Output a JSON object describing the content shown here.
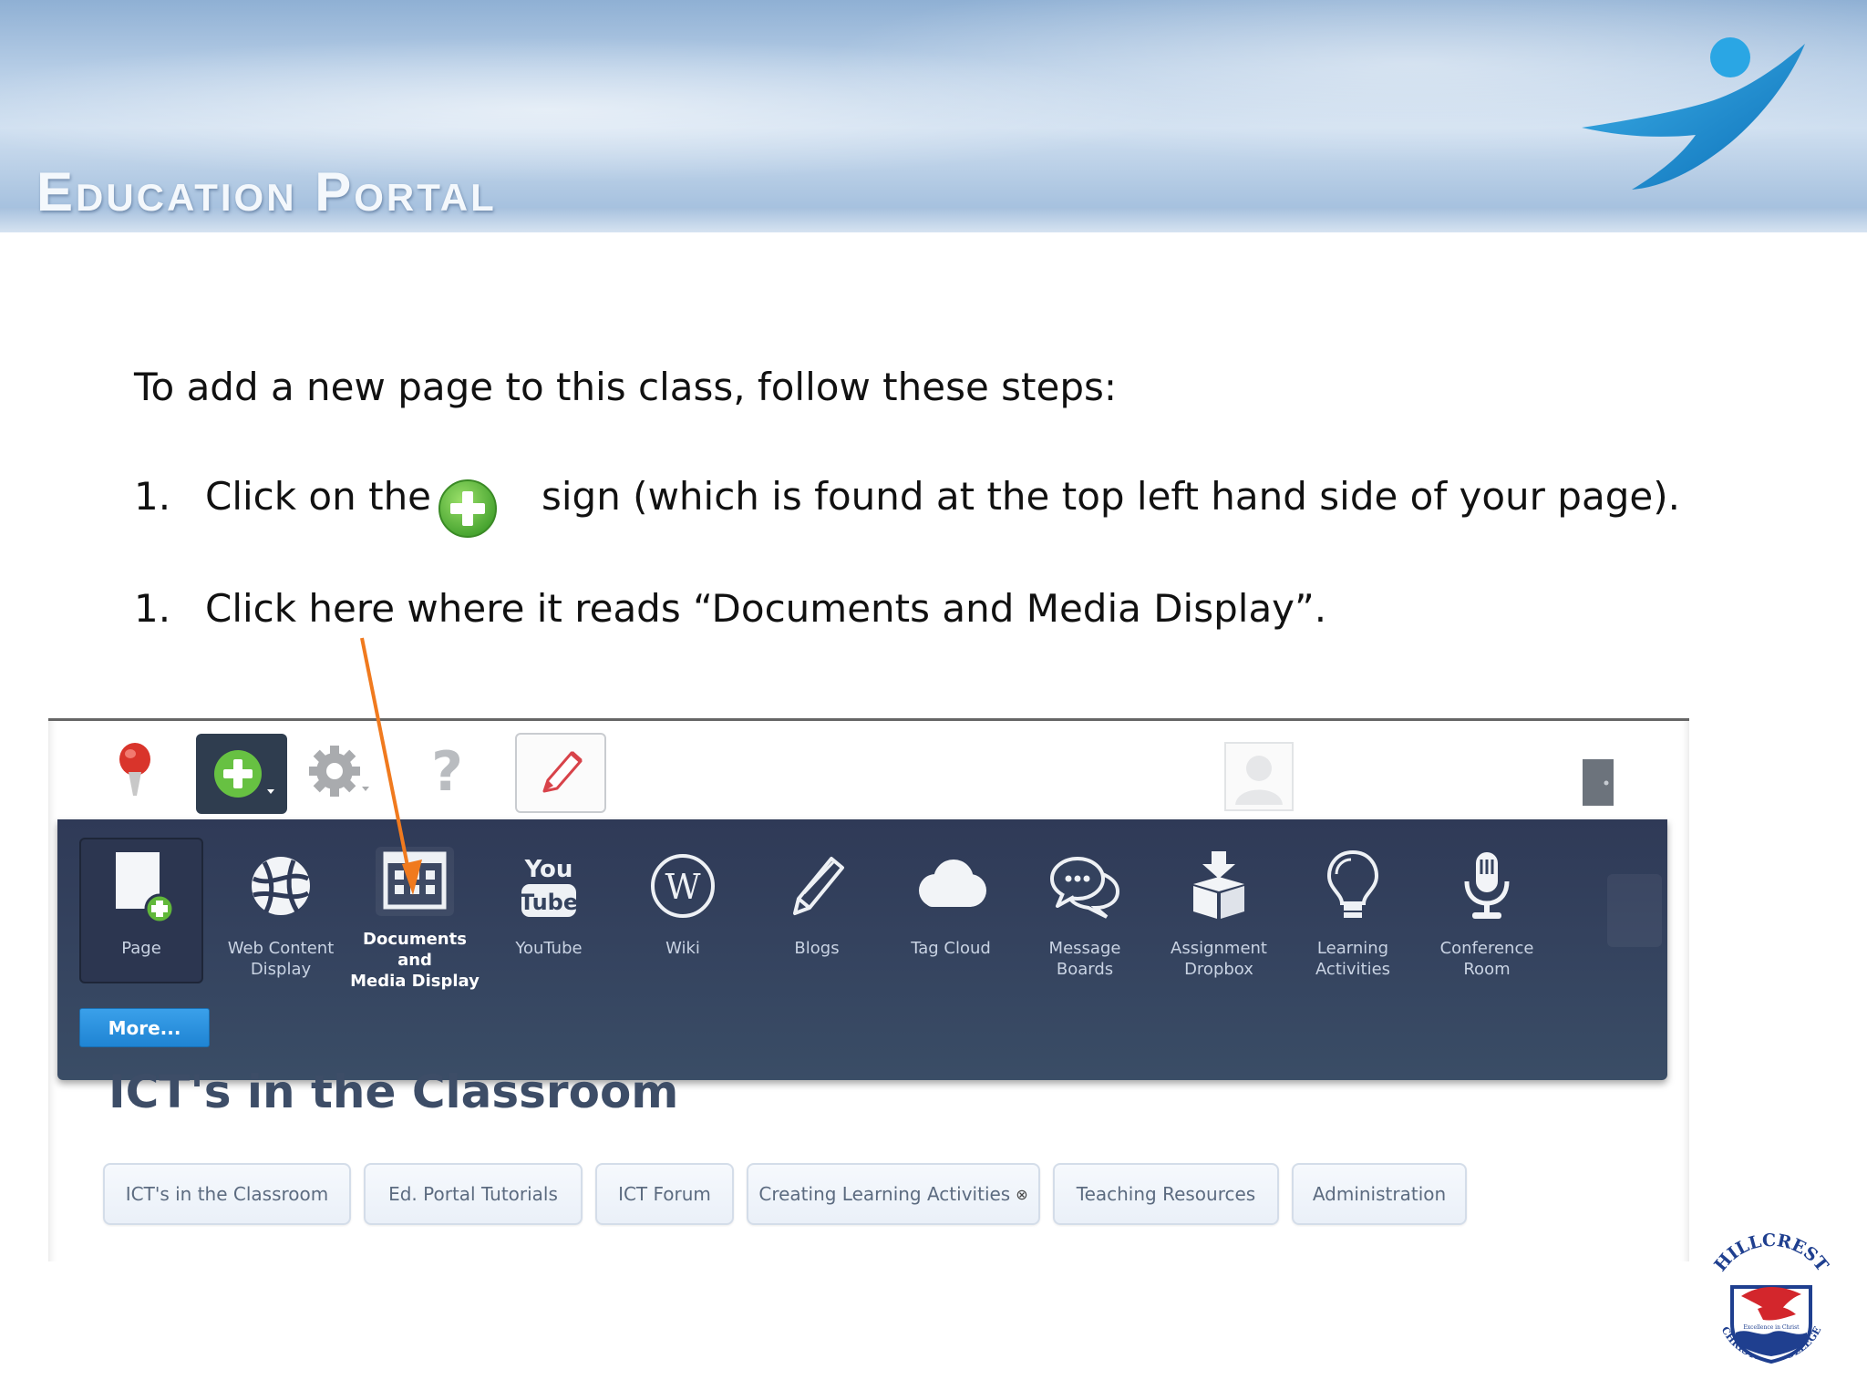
{
  "banner": {
    "title": "Education Portal"
  },
  "instructions": {
    "intro": "To add a new page to this class, follow these steps:",
    "step1_num": "1.",
    "step1_before": "Click on the",
    "step1_after": "sign (which is found at the top left hand side of your page).",
    "step2_num": "1.",
    "step2_text": "Click here where it reads “Documents and Media Display”."
  },
  "toolbar": {
    "icons": [
      "pin-icon",
      "add-icon",
      "gear-icon",
      "help-icon",
      "edit-icon",
      "avatar-icon",
      "sign-out-icon"
    ],
    "help_glyph": "?"
  },
  "add_panel": {
    "items": [
      {
        "label": "Page",
        "icon": "page-add-icon"
      },
      {
        "label": "Web Content\nDisplay",
        "icon": "globe-icon"
      },
      {
        "label": "Documents and\nMedia Display",
        "icon": "grid-icon",
        "selected": true
      },
      {
        "label": "YouTube",
        "icon": "youtube-icon"
      },
      {
        "label": "Wiki",
        "icon": "wikipedia-icon"
      },
      {
        "label": "Blogs",
        "icon": "pencil-icon"
      },
      {
        "label": "Tag Cloud",
        "icon": "cloud-icon"
      },
      {
        "label": "Message\nBoards",
        "icon": "speech-bubbles-icon"
      },
      {
        "label": "Assignment\nDropbox",
        "icon": "dropbox-icon"
      },
      {
        "label": "Learning\nActivities",
        "icon": "lightbulb-icon"
      },
      {
        "label": "Conference\nRoom",
        "icon": "microphone-icon"
      }
    ],
    "more_label": "More..."
  },
  "site": {
    "title": "ICT's in the Classroom",
    "tabs": [
      {
        "label": "ICT's in the Classroom"
      },
      {
        "label": "Ed. Portal Tutorials"
      },
      {
        "label": "ICT Forum"
      },
      {
        "label": "Creating Learning Activities",
        "has_close": true,
        "close_glyph": "⊗"
      },
      {
        "label": "Teaching Resources"
      },
      {
        "label": "Administration"
      }
    ]
  },
  "crest": {
    "top_text": "HILLCREST",
    "bottom_text": "CHRISTIAN COLLEGE",
    "motto": "Excellence in Christ"
  },
  "colors": {
    "panel_bg": "#34425e",
    "add_green": "#5cb83a",
    "more_blue": "#2a8fdc",
    "arrow_orange": "#f07a1e"
  }
}
